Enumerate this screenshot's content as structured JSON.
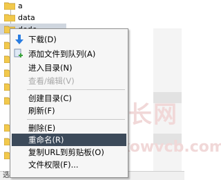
{
  "tree": {
    "items": [
      {
        "label": "a"
      },
      {
        "label": "data"
      },
      {
        "label": "dede"
      }
    ]
  },
  "status": {
    "text": "选择了 1 个文件夹"
  },
  "watermark": {
    "text": "站长网",
    "sub": "gkowvcb.com"
  },
  "menu": {
    "download": "下载(D)",
    "add_queue": "添加文件到队列(A)",
    "enter_dir": "进入目录(N)",
    "view_edit": "查看/编辑(V)",
    "create_dir": "创建目录(C)",
    "refresh": "刷新(F)",
    "delete": "删除(E)",
    "rename": "重命名(R)",
    "copy_url": "复制URL到剪贴板(O)",
    "file_perm": "文件权限(F)..."
  },
  "colors": {
    "menu_highlight": "#3c4a5a",
    "download_icon": "#2a7de1",
    "add_icon": "#3aa33a"
  }
}
